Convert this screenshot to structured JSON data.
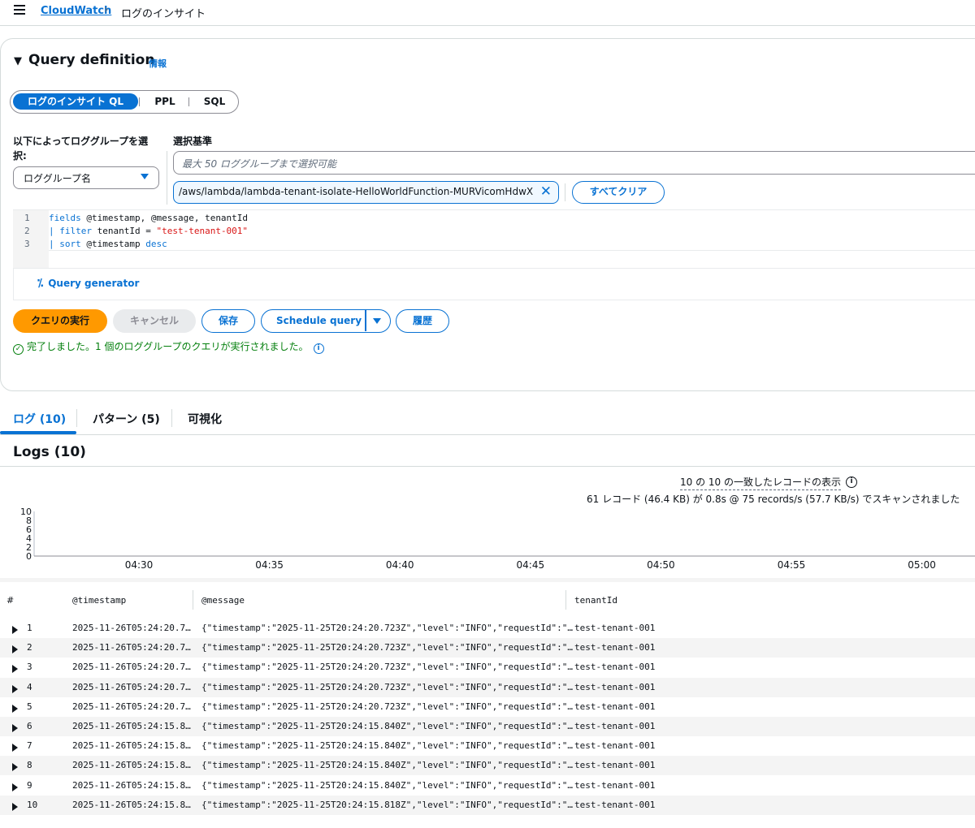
{
  "breadcrumb": {
    "service": "CloudWatch",
    "current": "ログのインサイト"
  },
  "query_definition": {
    "title": "Query definition",
    "info": "情報",
    "languages": [
      "ログのインサイト QL",
      "PPL",
      "SQL"
    ],
    "select_label": "以下によってロググループを選択:",
    "select_value": "ロググループ名",
    "criteria_label": "選択基準",
    "log_group_placeholder": "最大 50 ロググループまで選択可能",
    "selected_group": "/aws/lambda/lambda-tenant-isolate-HelloWorldFunction-MURVicomHdwX",
    "clear_all": "すべてクリア",
    "code_lines": [
      {
        "num": "1",
        "kw": "fields",
        "rest": " @timestamp, @message, tenantId"
      },
      {
        "num": "2",
        "kw": "| filter",
        "rest": " tenantId = ",
        "str": "\"test-tenant-001\""
      },
      {
        "num": "3",
        "kw": "| sort",
        "rest": " @timestamp ",
        "kw2": "desc"
      }
    ],
    "query_generator": "Query generator"
  },
  "actions": {
    "run": "クエリの実行",
    "cancel": "キャンセル",
    "save": "保存",
    "schedule": "Schedule query",
    "history": "履歴"
  },
  "status": "完了しました。1 個のロググループのクエリが実行されました。",
  "tabs": [
    "ログ (10)",
    "パターン (5)",
    "可視化"
  ],
  "logs_title": "Logs (10)",
  "summary": {
    "match": "10 の 10 の一致したレコードの表示",
    "scan": "61 レコード (46.4 KB) が 0.8s @ 75 records/s (57.7 KB/s) でスキャンされました"
  },
  "chart_data": {
    "type": "bar",
    "categories": [
      "04:30",
      "04:35",
      "04:40",
      "04:45",
      "04:50",
      "04:55",
      "05:00"
    ],
    "y_ticks": [
      "10",
      "8",
      "6",
      "4",
      "2",
      "0"
    ],
    "ylim": [
      0,
      10
    ],
    "values": [
      0,
      0,
      0,
      0,
      0,
      0,
      0
    ]
  },
  "table": {
    "headers": [
      "#",
      "@timestamp",
      "@message",
      "tenantId"
    ],
    "rows": [
      {
        "n": "1",
        "ts": "2025-11-26T05:24:20.7…",
        "msg": "{\"timestamp\":\"2025-11-25T20:24:20.723Z\",\"level\":\"INFO\",\"requestId\":\"…",
        "tenant": "test-tenant-001"
      },
      {
        "n": "2",
        "ts": "2025-11-26T05:24:20.7…",
        "msg": "{\"timestamp\":\"2025-11-25T20:24:20.723Z\",\"level\":\"INFO\",\"requestId\":\"…",
        "tenant": "test-tenant-001"
      },
      {
        "n": "3",
        "ts": "2025-11-26T05:24:20.7…",
        "msg": "{\"timestamp\":\"2025-11-25T20:24:20.723Z\",\"level\":\"INFO\",\"requestId\":\"…",
        "tenant": "test-tenant-001"
      },
      {
        "n": "4",
        "ts": "2025-11-26T05:24:20.7…",
        "msg": "{\"timestamp\":\"2025-11-25T20:24:20.723Z\",\"level\":\"INFO\",\"requestId\":\"…",
        "tenant": "test-tenant-001"
      },
      {
        "n": "5",
        "ts": "2025-11-26T05:24:20.7…",
        "msg": "{\"timestamp\":\"2025-11-25T20:24:20.723Z\",\"level\":\"INFO\",\"requestId\":\"…",
        "tenant": "test-tenant-001"
      },
      {
        "n": "6",
        "ts": "2025-11-26T05:24:15.8…",
        "msg": "{\"timestamp\":\"2025-11-25T20:24:15.840Z\",\"level\":\"INFO\",\"requestId\":\"…",
        "tenant": "test-tenant-001"
      },
      {
        "n": "7",
        "ts": "2025-11-26T05:24:15.8…",
        "msg": "{\"timestamp\":\"2025-11-25T20:24:15.840Z\",\"level\":\"INFO\",\"requestId\":\"…",
        "tenant": "test-tenant-001"
      },
      {
        "n": "8",
        "ts": "2025-11-26T05:24:15.8…",
        "msg": "{\"timestamp\":\"2025-11-25T20:24:15.840Z\",\"level\":\"INFO\",\"requestId\":\"…",
        "tenant": "test-tenant-001"
      },
      {
        "n": "9",
        "ts": "2025-11-26T05:24:15.8…",
        "msg": "{\"timestamp\":\"2025-11-25T20:24:15.840Z\",\"level\":\"INFO\",\"requestId\":\"…",
        "tenant": "test-tenant-001"
      },
      {
        "n": "10",
        "ts": "2025-11-26T05:24:15.8…",
        "msg": "{\"timestamp\":\"2025-11-25T20:24:15.818Z\",\"level\":\"INFO\",\"requestId\":\"…",
        "tenant": "test-tenant-001"
      }
    ]
  }
}
